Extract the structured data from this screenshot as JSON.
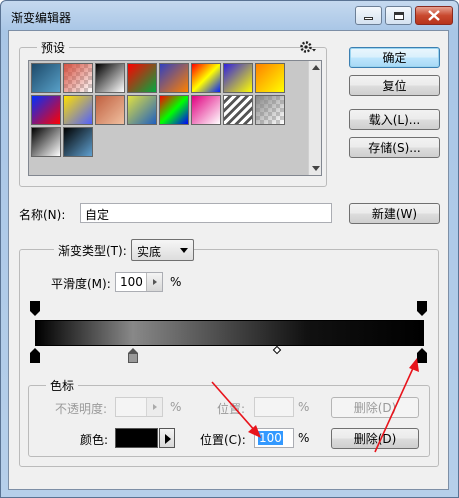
{
  "window": {
    "title": "渐变编辑器"
  },
  "titlebar": {
    "minimize": "minimize",
    "maximize": "maximize",
    "close": "close"
  },
  "presets": {
    "legend": "预设",
    "menu_icon": "gear-icon",
    "swatches": [
      "#1d4a6a|#58a0c8",
      "checker|#d45040",
      "#000|#fff",
      "#ff0000|#00aa40",
      "#3040c0|#ff8000",
      "#ff0000|#ffff00|#0020ff",
      "#3020e0|#ffff00",
      "#ff8000|#ffff00",
      "#0030ff|#ff0000",
      "#ffe000|#5060ff",
      "#c06040|#f0c0a0",
      "#e0e040|#2060c0",
      "#ff0000|#00ff00|#0000ff",
      "#e00080|#ffffff",
      "stripes|#555",
      "checker|#888",
      "#000|#ffffff",
      "#000|#60a0d0"
    ]
  },
  "buttons": {
    "ok": "确定",
    "reset": "复位",
    "load": "载入(L)...",
    "save": "存储(S)...",
    "new": "新建(W)"
  },
  "name_field": {
    "label": "名称(N):",
    "value": "自定"
  },
  "gradient_type": {
    "label": "渐变类型(T):",
    "value": "实底"
  },
  "smoothness": {
    "label": "平滑度(M):",
    "value": "100",
    "unit": "%"
  },
  "color_stops": {
    "legend": "色标",
    "opacity_label": "不透明度:",
    "opacity_unit": "%",
    "opacity_position_label": "位置:",
    "opacity_position_unit": "%",
    "opacity_delete": "删除(D)",
    "color_label": "颜色:",
    "color_value": "#000000",
    "position_label": "位置(C):",
    "position_value": "100",
    "position_unit": "%",
    "delete": "删除(D)"
  },
  "colors": {
    "annotation_arrow": "#e8141c",
    "accent": "#3c7fb1"
  }
}
